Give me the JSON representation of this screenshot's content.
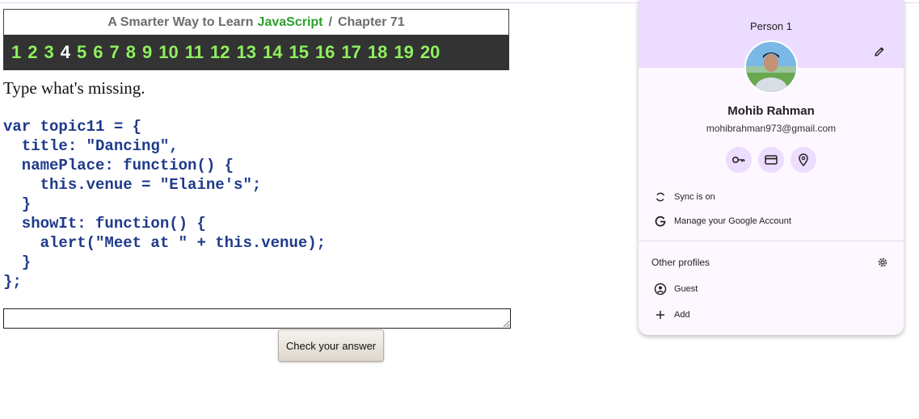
{
  "exercise": {
    "book_title": "A Smarter Way to Learn",
    "language": "JavaScript",
    "separator": "/",
    "chapter": "Chapter 71",
    "exercise_numbers": [
      "1",
      "2",
      "3",
      "4",
      "5",
      "6",
      "7",
      "8",
      "9",
      "10",
      "11",
      "12",
      "13",
      "14",
      "15",
      "16",
      "17",
      "18",
      "19",
      "20"
    ],
    "current_exercise": "4",
    "instruction": "Type what's missing.",
    "code": "var topic11 = {\n  title: \"Dancing\",\n  namePlace: function() {\n    this.venue = \"Elaine's\";\n  }\n  showIt: function() {\n    alert(\"Meet at \" + this.venue);\n  }\n};",
    "answer_value": "",
    "check_button": "Check your answer"
  },
  "profile_popup": {
    "title": "Person 1",
    "name": "Mohib Rahman",
    "email": "mohibrahman973@gmail.com",
    "quick_actions": [
      "key-icon",
      "credit-card-icon",
      "location-pin-icon"
    ],
    "sync_label": "Sync is on",
    "manage_label": "Manage your Google Account",
    "other_profiles_label": "Other profiles",
    "guest_label": "Guest",
    "add_label": "Add"
  },
  "colors": {
    "code_text": "#1e3a8a",
    "number_link": "#8ef05f",
    "number_bar_bg": "#333333",
    "javascript_green": "#2e9e2e",
    "popup_header": "#ecdcff",
    "popup_bg": "#fdf7ff"
  }
}
